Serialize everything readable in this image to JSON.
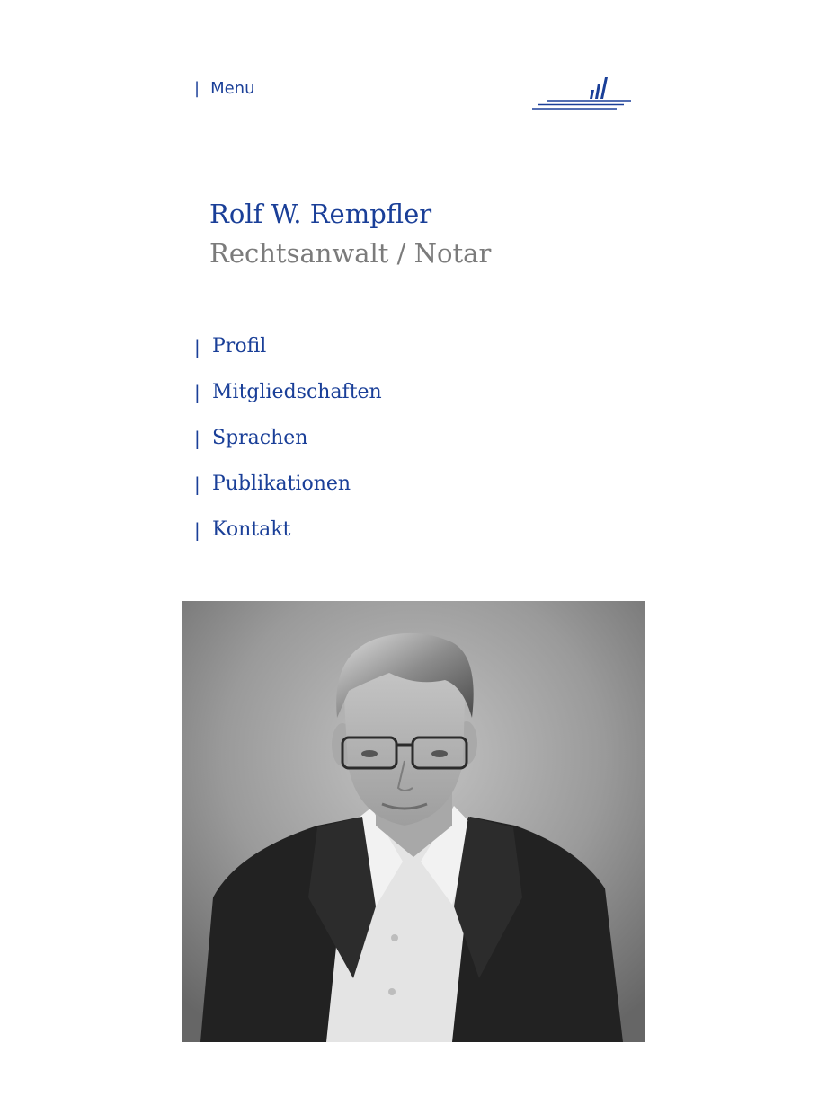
{
  "header": {
    "menu_bar": "|",
    "menu_label": "Menu",
    "logo_icon": "firm-logo-icon"
  },
  "person": {
    "name": "Rolf W. Rempfler",
    "role": "Rechtsanwalt / Notar"
  },
  "subnav": {
    "items": [
      {
        "bar": "|",
        "label": "Profil"
      },
      {
        "bar": "|",
        "label": "Mitgliedschaften"
      },
      {
        "bar": "|",
        "label": "Sprachen"
      },
      {
        "bar": "|",
        "label": "Publikationen"
      },
      {
        "bar": "|",
        "label": "Kontakt"
      }
    ]
  },
  "colors": {
    "brand_blue": "#1a3f98",
    "role_gray": "#7b7b7b",
    "background": "#ffffff"
  },
  "portrait": {
    "style": "black-and-white portrait photo"
  }
}
